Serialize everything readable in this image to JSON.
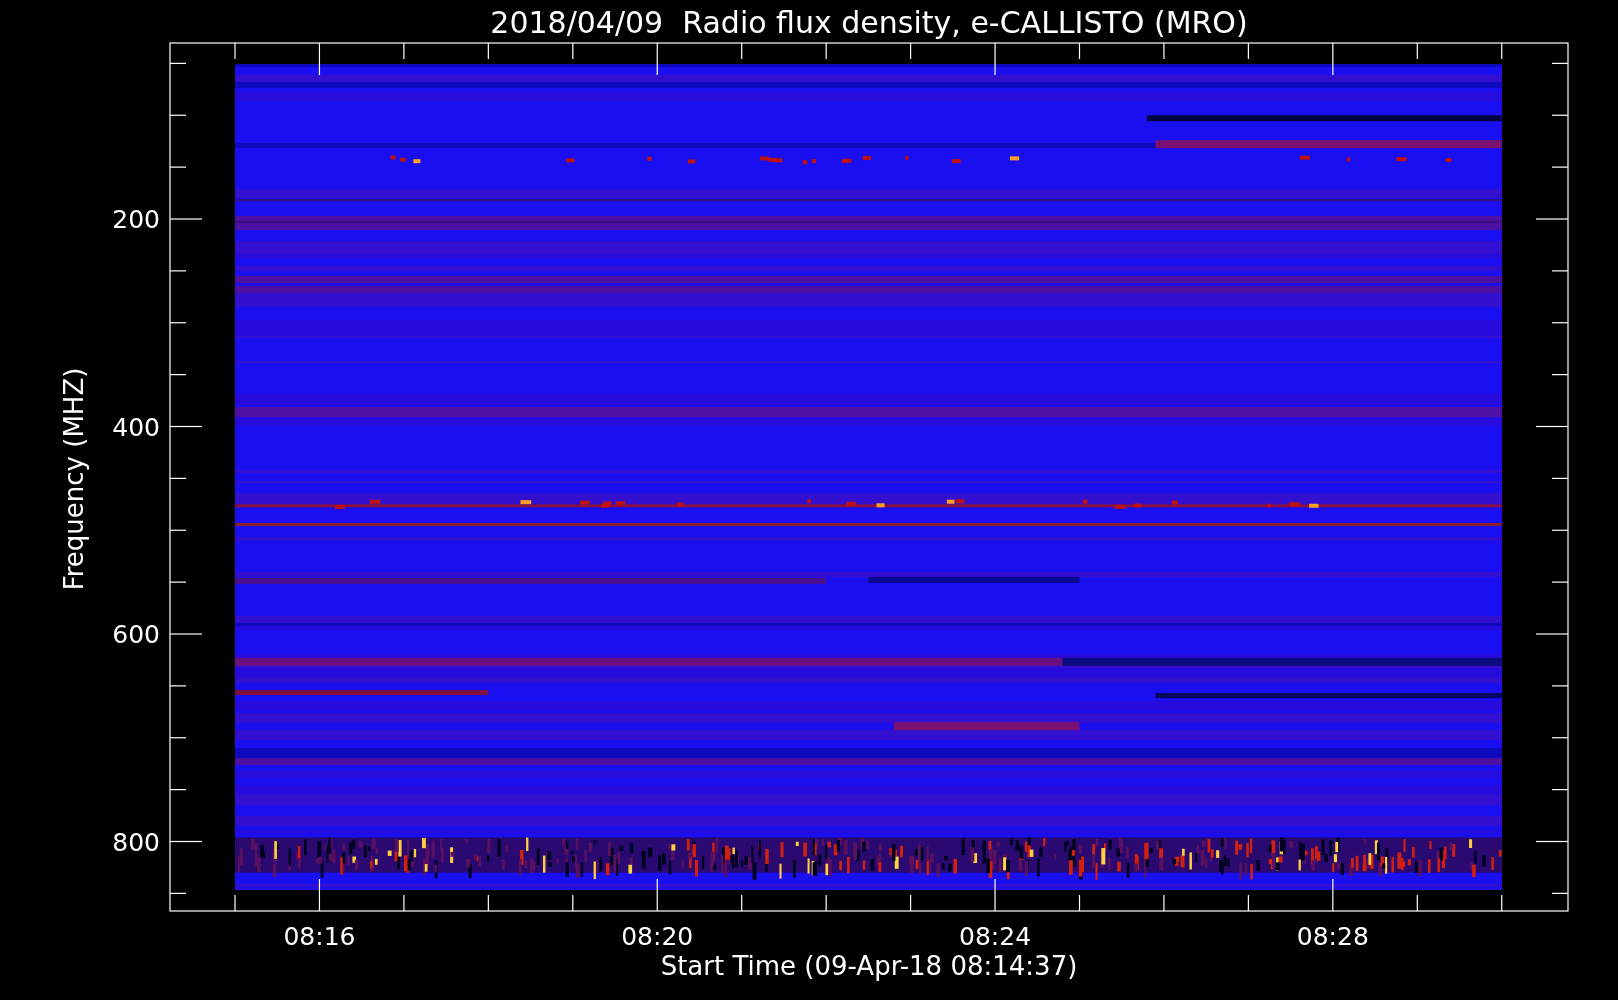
{
  "plot": {
    "title": "2018/04/09  Radio flux density, e-CALLISTO (MRO)",
    "xlabel": "Start Time (09-Apr-18 08:14:37)",
    "ylabel": "Frequency (MHZ)",
    "xticks": [
      "08:16",
      "08:20",
      "08:24",
      "08:28"
    ],
    "yticks": [
      "200",
      "400",
      "600",
      "800"
    ]
  }
}
